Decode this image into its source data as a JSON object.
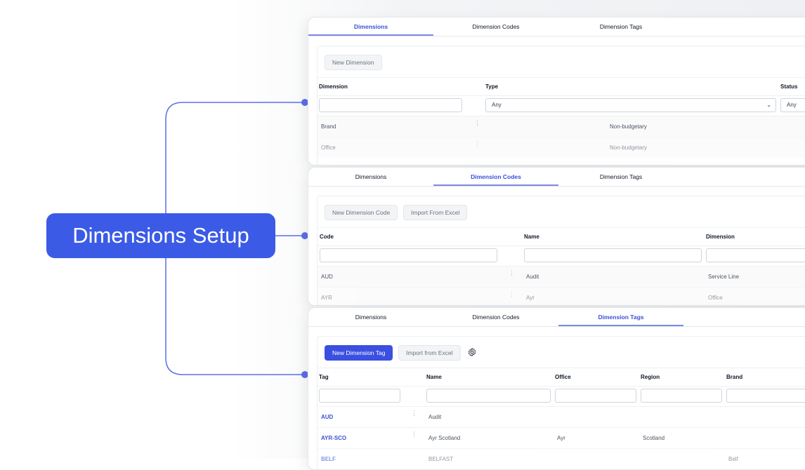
{
  "callout": {
    "label": "Dimensions Setup"
  },
  "card1": {
    "tabs": [
      "Dimensions",
      "Dimension Codes",
      "Dimension Tags"
    ],
    "new_button": "New Dimension",
    "headers": {
      "dimension": "Dimension",
      "type": "Type",
      "status": "Status"
    },
    "filters": {
      "type_value": "Any",
      "status_value": "Any"
    },
    "rows": [
      {
        "name": "Brand",
        "type": "Non-budgetary"
      },
      {
        "name": "Office",
        "type": "Non-budgetary"
      }
    ]
  },
  "card2": {
    "tabs": [
      "Dimensions",
      "Dimension Codes",
      "Dimension Tags"
    ],
    "new_button": "New Dimension Code",
    "import_button": "Import From Excel",
    "headers": {
      "code": "Code",
      "name": "Name",
      "dimension": "Dimension"
    },
    "rows": [
      {
        "code": "AUD",
        "name": "Audit",
        "dimension": "Service Line"
      },
      {
        "code": "AYR",
        "name": "Ayr",
        "dimension": "Office"
      }
    ]
  },
  "card3": {
    "tabs": [
      "Dimensions",
      "Dimension Codes",
      "Dimension Tags"
    ],
    "new_button": "New Dimension Tag",
    "import_button": "Import from Excel",
    "headers": {
      "tag": "Tag",
      "name": "Name",
      "office": "Office",
      "region": "Region",
      "brand": "Brand"
    },
    "rows": [
      {
        "tag": "AUD",
        "name": "Audit",
        "office": "",
        "region": "",
        "brand": ""
      },
      {
        "tag": "AYR-SCO",
        "name": "Ayr Scotland",
        "office": "Ayr",
        "region": "Scotland",
        "brand": ""
      },
      {
        "tag": "BELF",
        "name": "BELFAST",
        "office": "",
        "region": "",
        "brand": "Belf"
      }
    ]
  },
  "colors": {
    "accent": "#3b5be6",
    "connector": "#5b6ee8"
  }
}
